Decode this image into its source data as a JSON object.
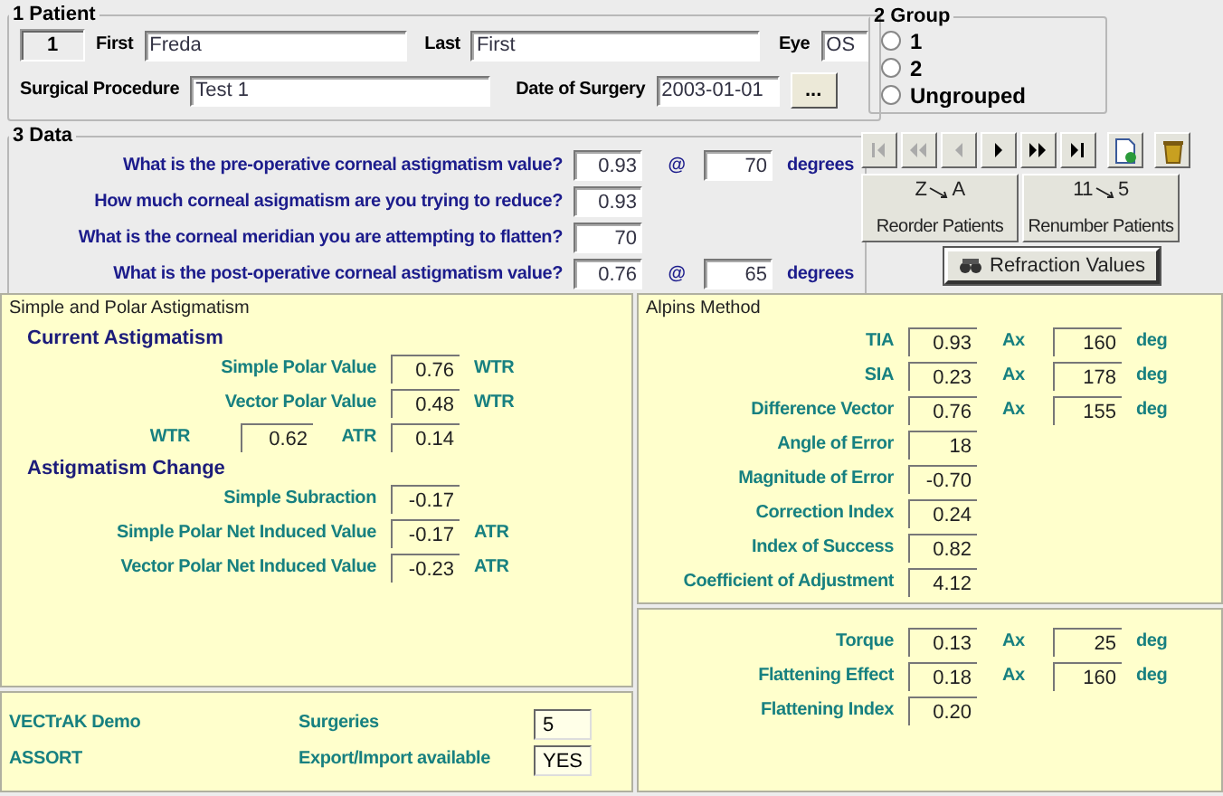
{
  "patient": {
    "title": "1 Patient",
    "number": "1",
    "first_label": "First",
    "first": "Freda",
    "last_label": "Last",
    "last": "First",
    "eye_label": "Eye",
    "eye": "OS",
    "procedure_label": "Surgical Procedure",
    "procedure": "Test 1",
    "date_label": "Date of Surgery",
    "date": "2003-01-01",
    "date_button": "..."
  },
  "group": {
    "title": "2 Group",
    "options": [
      {
        "label": "1",
        "selected": false
      },
      {
        "label": "2",
        "selected": false
      },
      {
        "label": "Ungrouped",
        "selected": false
      }
    ]
  },
  "data": {
    "title": "3 Data",
    "questions": [
      {
        "label": "What is the pre-operative corneal astigmatism value?",
        "value": "0.93",
        "at": "@",
        "angle": "70",
        "unit": "degrees"
      },
      {
        "label": "How much corneal asigmatism are you trying to reduce?",
        "value": "0.93"
      },
      {
        "label": "What is the corneal meridian you are attempting to flatten?",
        "value": "70"
      },
      {
        "label": "What is the post-operative corneal astigmatism value?",
        "value": "0.76",
        "at": "@",
        "angle": "65",
        "unit": "degrees"
      }
    ]
  },
  "nav": [
    {
      "kind": "first",
      "disabled": true
    },
    {
      "kind": "rewind",
      "disabled": true
    },
    {
      "kind": "previous",
      "disabled": true
    },
    {
      "kind": "next",
      "disabled": false
    },
    {
      "kind": "forward",
      "disabled": false
    },
    {
      "kind": "last",
      "disabled": false
    },
    {
      "kind": "new",
      "disabled": false
    },
    {
      "kind": "delete",
      "disabled": false
    }
  ],
  "actions": [
    {
      "label": "Reorder Patients",
      "from": "Z",
      "to": "A"
    },
    {
      "label": "Renumber Patients",
      "from": "11",
      "to": "5"
    }
  ],
  "refraction_button": "Refraction Values",
  "simple_polar": {
    "title": "Simple and Polar Astigmatism",
    "rows": [
      {
        "kind": "heading",
        "label": "Current Astigmatism"
      },
      {
        "kind": "value",
        "label": "Simple Polar Value",
        "value": "0.76",
        "unit": "WTR"
      },
      {
        "kind": "value",
        "label": "Vector Polar Value",
        "value": "0.48",
        "unit": "WTR"
      },
      {
        "kind": "pair",
        "label": "WTR",
        "value": "0.62",
        "label_2": "ATR",
        "value_2": "0.14"
      },
      {
        "kind": "heading",
        "label": "Astigmatism Change"
      },
      {
        "kind": "value",
        "label": "Simple Subraction",
        "value": "-0.17"
      },
      {
        "kind": "value",
        "label": "Simple Polar Net Induced Value",
        "value": "-0.17",
        "unit": "ATR"
      },
      {
        "kind": "value",
        "label": "Vector Polar Net Induced Value",
        "value": "-0.23",
        "unit": "ATR"
      }
    ]
  },
  "footer": {
    "names": [
      "VECTrAK Demo",
      "ASSORT"
    ],
    "fields": [
      {
        "label": "Surgeries",
        "value": "5"
      },
      {
        "label": "Export/Import available",
        "value": "YES"
      }
    ]
  },
  "alpins": {
    "title": "Alpins Method",
    "rows": [
      {
        "label": "TIA",
        "value": "0.93",
        "axis_label": "Ax",
        "axis": "160",
        "unit": "deg"
      },
      {
        "label": "SIA",
        "value": "0.23",
        "axis_label": "Ax",
        "axis": "178",
        "unit": "deg"
      },
      {
        "label": "Difference Vector",
        "value": "0.76",
        "axis_label": "Ax",
        "axis": "155",
        "unit": "deg"
      },
      {
        "label": "Angle of Error",
        "value": "18"
      },
      {
        "label": "Magnitude of Error",
        "value": "-0.70"
      },
      {
        "label": "Correction Index",
        "value": "0.24"
      },
      {
        "label": "Index of Success",
        "value": "0.82"
      },
      {
        "label": "Coefficient of Adjustment",
        "value": "4.12"
      }
    ]
  },
  "flattening": {
    "rows": [
      {
        "label": "Torque",
        "value": "0.13",
        "axis_label": "Ax",
        "axis": "25",
        "unit": "deg"
      },
      {
        "label": "Flattening Effect",
        "value": "0.18",
        "axis_label": "Ax",
        "axis": "160",
        "unit": "deg"
      },
      {
        "label": "Flattening Index",
        "value": "0.20"
      }
    ]
  }
}
